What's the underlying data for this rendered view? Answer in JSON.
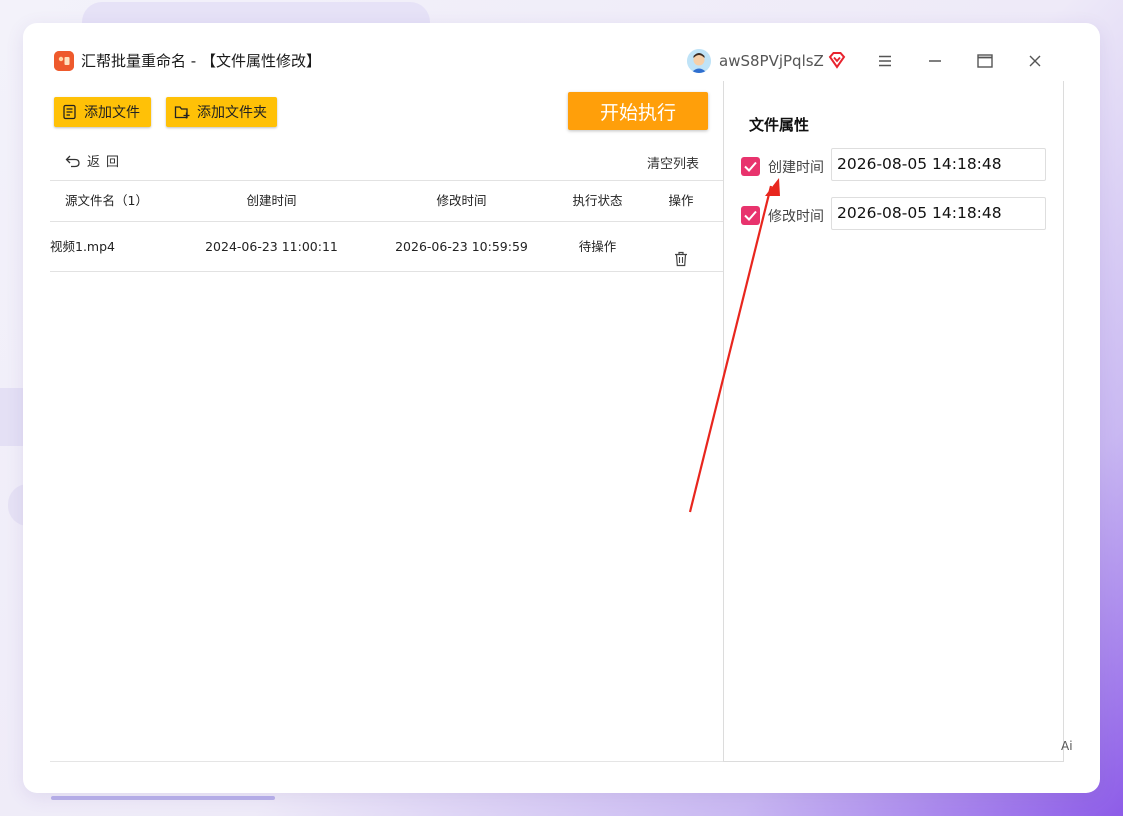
{
  "window": {
    "title": "汇帮批量重命名 - 【文件属性修改】",
    "logo_text": "",
    "username": "awS8PVjPqlsZ"
  },
  "toolbar": {
    "add_file_label": "添加文件",
    "add_folder_label": "添加文件夹",
    "start_label": "开始执行",
    "back_label": "返回",
    "clear_label": "清空列表"
  },
  "table": {
    "headers": [
      "源文件名（1）",
      "创建时间",
      "修改时间",
      "执行状态",
      "操作"
    ],
    "rows": [
      {
        "name": "视频1.mp4",
        "created": "2024-06-23 11:00:11",
        "modified": "2026-06-23 10:59:59",
        "status": "待操作"
      }
    ]
  },
  "panel": {
    "title": "文件属性",
    "created_label": "创建时间",
    "created_value": "2026-08-05 14:18:48",
    "created_checked": true,
    "modified_label": "修改时间",
    "modified_value": "2026-08-05 14:18:48",
    "modified_checked": true
  },
  "edge_text": "Ai",
  "colors": {
    "accent_yellow": "#ffc107",
    "start_orange": "#ff9f0a",
    "checkbox_pink": "#e8336d",
    "annotation_red": "#e8261e"
  }
}
